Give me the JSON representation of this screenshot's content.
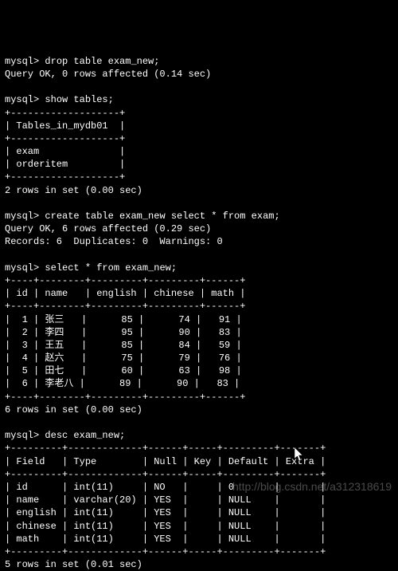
{
  "prompt": "mysql>",
  "cmd1": "drop table exam_new;",
  "res1": "Query OK, 0 rows affected (0.14 sec)",
  "cmd2": "show tables;",
  "show_tables": {
    "border": "+-------------------+",
    "header": "| Tables_in_mydb01  |",
    "rows": [
      "| exam              |",
      "| orderitem         |"
    ]
  },
  "res2": "2 rows in set (0.00 sec)",
  "cmd3": "create table exam_new select * from exam;",
  "res3a": "Query OK, 6 rows affected (0.29 sec)",
  "res3b": "Records: 6  Duplicates: 0  Warnings: 0",
  "cmd4": "select * from exam_new;",
  "select": {
    "border": "+----+--------+---------+---------+------+",
    "header": "| id | name   | english | chinese | math |",
    "rows": [
      "|  1 | 张三   |      85 |      74 |   91 |",
      "|  2 | 李四   |      95 |      90 |   83 |",
      "|  3 | 王五   |      85 |      84 |   59 |",
      "|  4 | 赵六   |      75 |      79 |   76 |",
      "|  5 | 田七   |      60 |      63 |   98 |",
      "|  6 | 李老八 |      89 |      90 |   83 |"
    ]
  },
  "res4": "6 rows in set (0.00 sec)",
  "cmd5": "desc exam_new;",
  "desc": {
    "border": "+---------+-------------+------+-----+---------+-------+",
    "header": "| Field   | Type        | Null | Key | Default | Extra |",
    "rows": [
      "| id      | int(11)     | NO   |     | 0       |       |",
      "| name    | varchar(20) | YES  |     | NULL    |       |",
      "| english | int(11)     | YES  |     | NULL    |       |",
      "| chinese | int(11)     | YES  |     | NULL    |       |",
      "| math    | int(11)     | YES  |     | NULL    |       |"
    ]
  },
  "res5": "5 rows in set (0.01 sec)",
  "watermark": "http://blog.csdn.net/a312318619",
  "chart_data": {
    "type": "table",
    "tables": [
      {
        "name": "show_tables",
        "columns": [
          "Tables_in_mydb01"
        ],
        "rows": [
          [
            "exam"
          ],
          [
            "orderitem"
          ]
        ]
      },
      {
        "name": "exam_new_data",
        "columns": [
          "id",
          "name",
          "english",
          "chinese",
          "math"
        ],
        "rows": [
          [
            1,
            "张三",
            85,
            74,
            91
          ],
          [
            2,
            "李四",
            95,
            90,
            83
          ],
          [
            3,
            "王五",
            85,
            84,
            59
          ],
          [
            4,
            "赵六",
            75,
            79,
            76
          ],
          [
            5,
            "田七",
            60,
            63,
            98
          ],
          [
            6,
            "李老八",
            89,
            90,
            83
          ]
        ]
      },
      {
        "name": "exam_new_desc",
        "columns": [
          "Field",
          "Type",
          "Null",
          "Key",
          "Default",
          "Extra"
        ],
        "rows": [
          [
            "id",
            "int(11)",
            "NO",
            "",
            "0",
            ""
          ],
          [
            "name",
            "varchar(20)",
            "YES",
            "",
            "NULL",
            ""
          ],
          [
            "english",
            "int(11)",
            "YES",
            "",
            "NULL",
            ""
          ],
          [
            "chinese",
            "int(11)",
            "YES",
            "",
            "NULL",
            ""
          ],
          [
            "math",
            "int(11)",
            "YES",
            "",
            "NULL",
            ""
          ]
        ]
      }
    ]
  }
}
